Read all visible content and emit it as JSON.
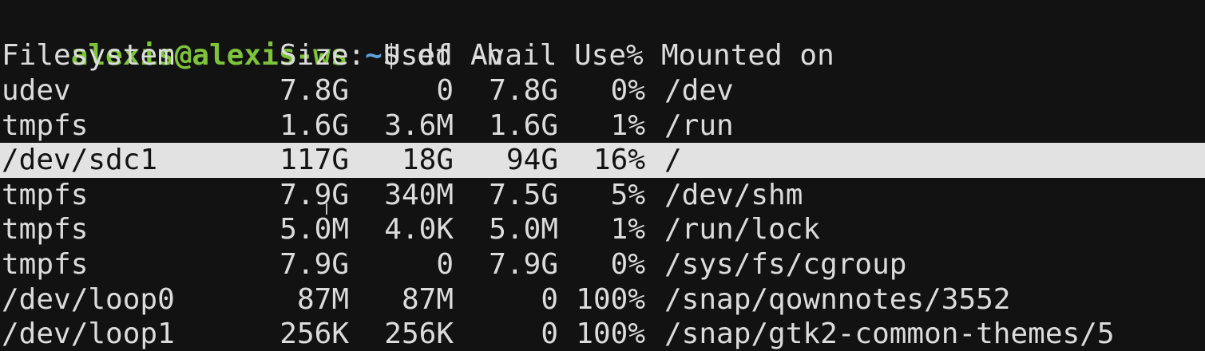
{
  "prompt": {
    "user_host": "alexis@alexis-ws",
    "colon": ":",
    "path": "~",
    "dollar": "$",
    "command": "df -h"
  },
  "columns": [
    "Filesystem",
    "Size",
    "Used",
    "Avail",
    "Use%",
    "Mounted on"
  ],
  "rows": [
    {
      "filesystem": "udev",
      "size": "7.8G",
      "used": "0",
      "avail": "7.8G",
      "use": "0%",
      "mounted": "/dev"
    },
    {
      "filesystem": "tmpfs",
      "size": "1.6G",
      "used": "3.6M",
      "avail": "1.6G",
      "use": "1%",
      "mounted": "/run"
    },
    {
      "filesystem": "/dev/sdc1",
      "size": "117G",
      "used": "18G",
      "avail": "94G",
      "use": "16%",
      "mounted": "/"
    },
    {
      "filesystem": "tmpfs",
      "size": "7.9G",
      "used": "340M",
      "avail": "7.5G",
      "use": "5%",
      "mounted": "/dev/shm"
    },
    {
      "filesystem": "tmpfs",
      "size": "5.0M",
      "used": "4.0K",
      "avail": "5.0M",
      "use": "1%",
      "mounted": "/run/lock"
    },
    {
      "filesystem": "tmpfs",
      "size": "7.9G",
      "used": "0",
      "avail": "7.9G",
      "use": "0%",
      "mounted": "/sys/fs/cgroup"
    },
    {
      "filesystem": "/dev/loop0",
      "size": "87M",
      "used": "87M",
      "avail": "0",
      "use": "100%",
      "mounted": "/snap/qownnotes/3552"
    },
    {
      "filesystem": "/dev/loop1",
      "size": "256K",
      "used": "256K",
      "avail": "0",
      "use": "100%",
      "mounted": "/snap/gtk2-common-themes/5"
    }
  ],
  "colors": {
    "background": "#121212",
    "text": "#dcdcdc",
    "prompt_user": "#7ec43a",
    "prompt_path": "#5aa2e0",
    "highlight_bg": "#e2e2e2"
  }
}
